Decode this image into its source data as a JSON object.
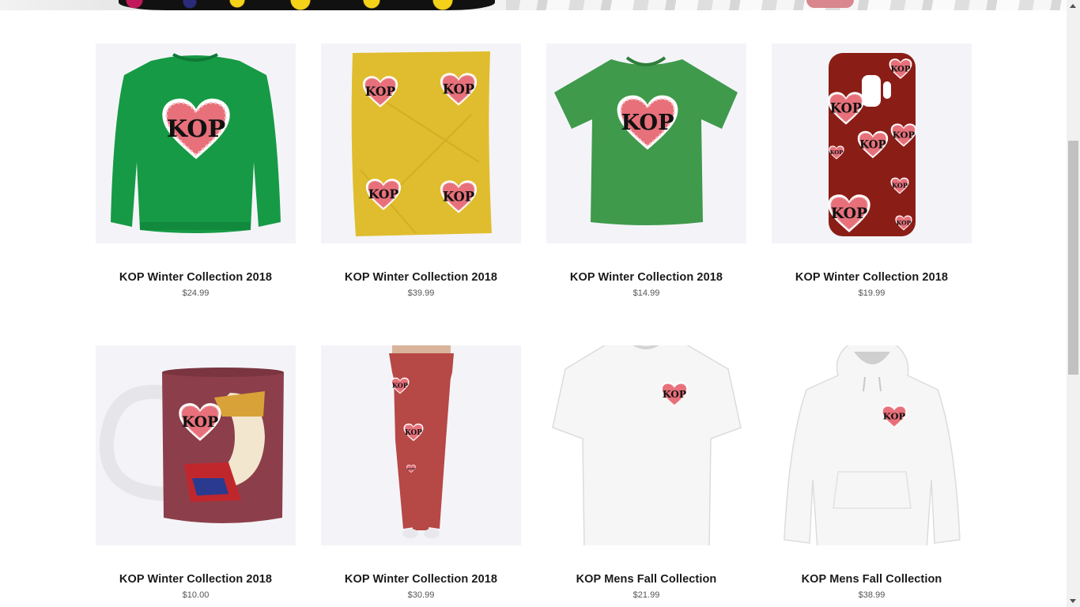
{
  "products": [
    {
      "title": "KOP Winter Collection 2018",
      "price": "$24.99",
      "image": "green-sweatshirt"
    },
    {
      "title": "KOP Winter Collection 2018",
      "price": "$39.99",
      "image": "yellow-towel"
    },
    {
      "title": "KOP Winter Collection 2018",
      "price": "$14.99",
      "image": "green-tshirt"
    },
    {
      "title": "KOP Winter Collection 2018",
      "price": "$19.99",
      "image": "red-phone-case"
    },
    {
      "title": "KOP Winter Collection 2018",
      "price": "$10.00",
      "image": "maroon-mug"
    },
    {
      "title": "KOP Winter Collection 2018",
      "price": "$30.99",
      "image": "red-leggings"
    },
    {
      "title": "KOP Mens Fall Collection",
      "price": "$21.99",
      "image": "white-tshirt"
    },
    {
      "title": "KOP Mens Fall Collection",
      "price": "$38.99",
      "image": "white-hoodie"
    }
  ],
  "logo_text": "KOP",
  "colors": {
    "sweatshirt": "#169a45",
    "towel": "#e0bd2e",
    "tshirt": "#3f9a4c",
    "phonecase": "#8a1e16",
    "mug": "#8c3f4a",
    "leggings": "#b64846",
    "thumb_bg": "#f4f4f8"
  }
}
